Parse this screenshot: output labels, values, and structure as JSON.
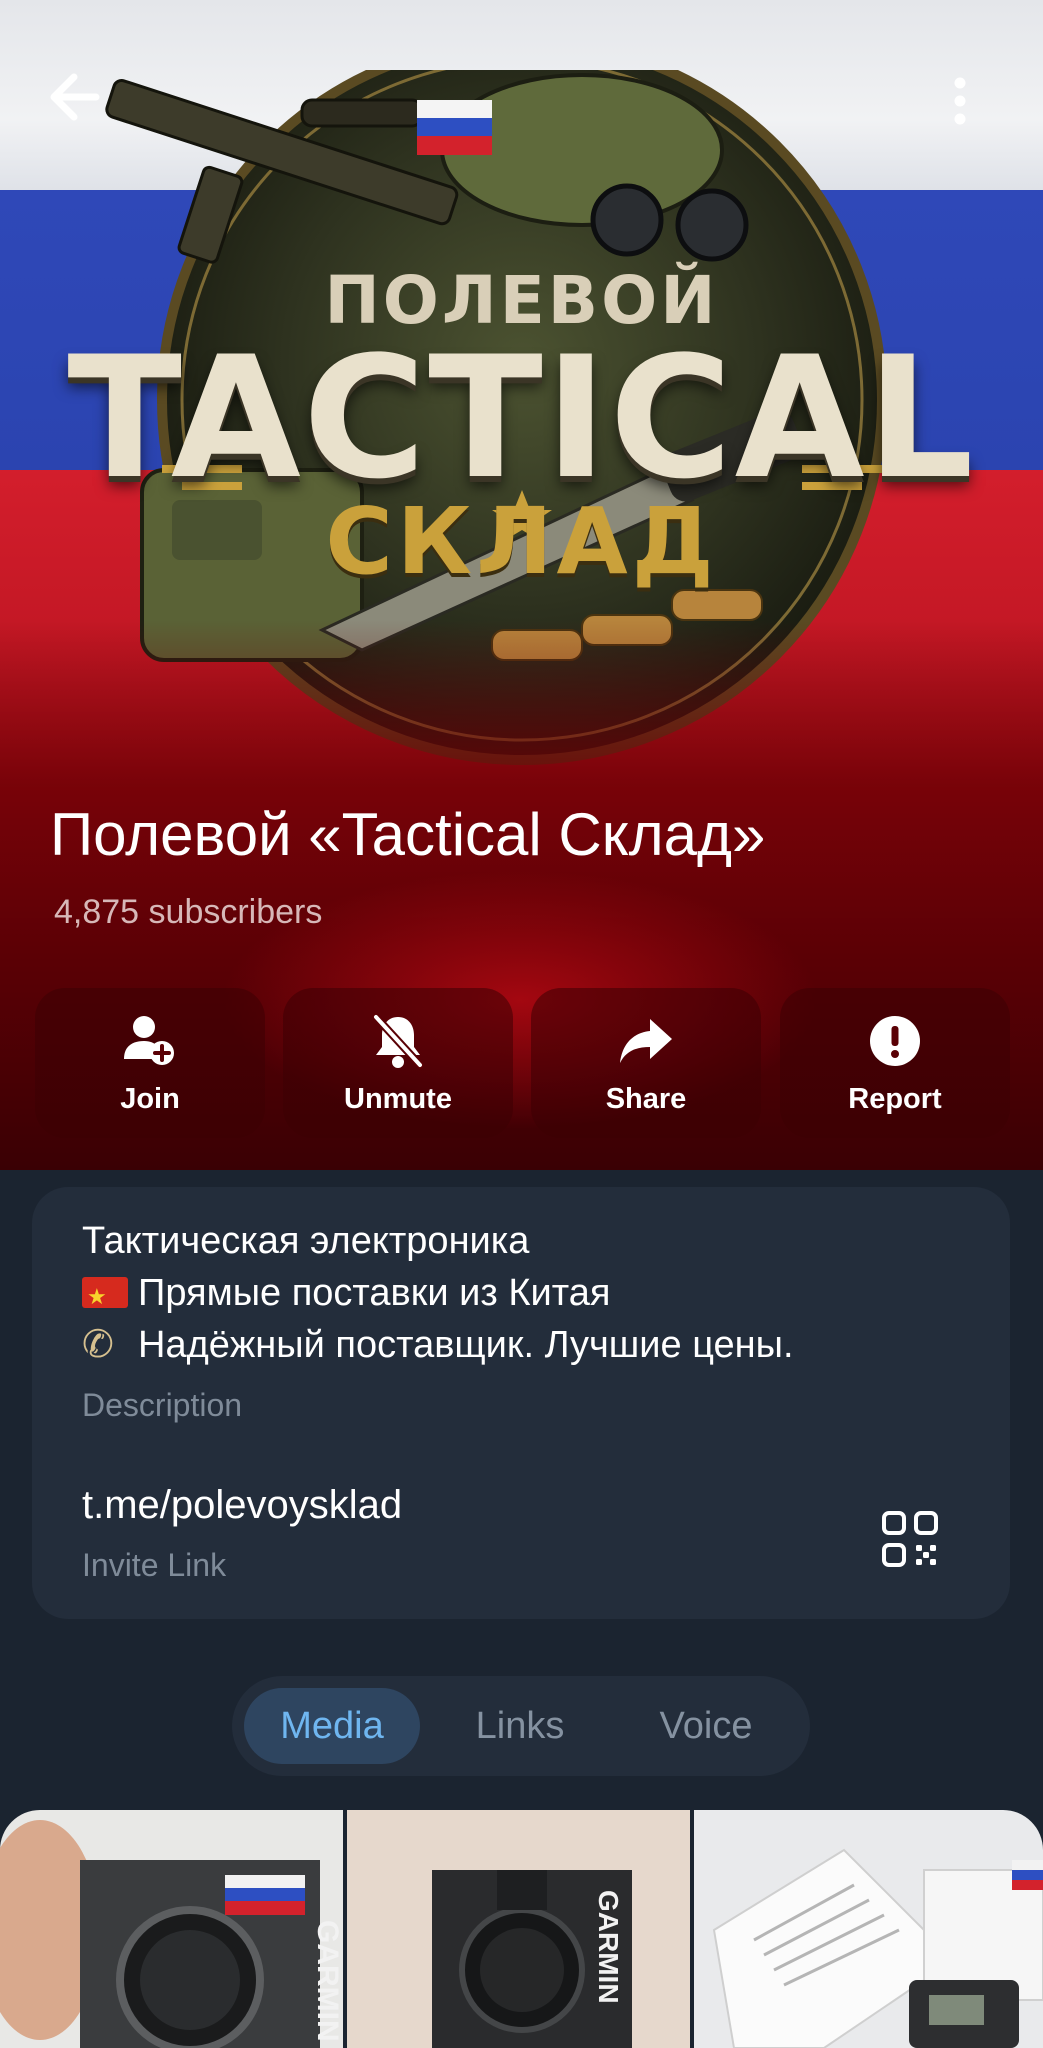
{
  "logo": {
    "line1": "ПОЛЕВОЙ",
    "line2": "TACTICAL",
    "line3": "СКЛАД"
  },
  "header": {
    "back_icon": "arrow-left-icon",
    "menu_icon": "more-vertical-icon"
  },
  "channel": {
    "title": "Полевой «Tactical Склад»",
    "subscribers": "4,875 subscribers"
  },
  "actions": [
    {
      "label": "Join",
      "icon": "add-user-icon"
    },
    {
      "label": "Unmute",
      "icon": "bell-off-icon"
    },
    {
      "label": "Share",
      "icon": "share-arrow-icon"
    },
    {
      "label": "Report",
      "icon": "alert-circle-icon"
    }
  ],
  "info": {
    "description_lines": [
      "Тактическая электроника",
      "Прямые поставки из Китая",
      "Надёжный поставщик. Лучшие цены."
    ],
    "description_caption": "Description",
    "link": "t.me/polevoysklad",
    "link_caption": "Invite Link",
    "qr_icon": "qr-code-icon"
  },
  "tabs": [
    {
      "label": "Media",
      "active": true
    },
    {
      "label": "Links",
      "active": false
    },
    {
      "label": "Voice",
      "active": false
    }
  ],
  "media": [
    {
      "brand_text": "GARMIN"
    },
    {
      "brand_text": "GARMIN"
    },
    {
      "brand_text": ""
    }
  ],
  "colors": {
    "background": "#1b2430",
    "card": "#232d3b",
    "accent": "#6fb6f0",
    "muted_text": "#7f8b99"
  }
}
